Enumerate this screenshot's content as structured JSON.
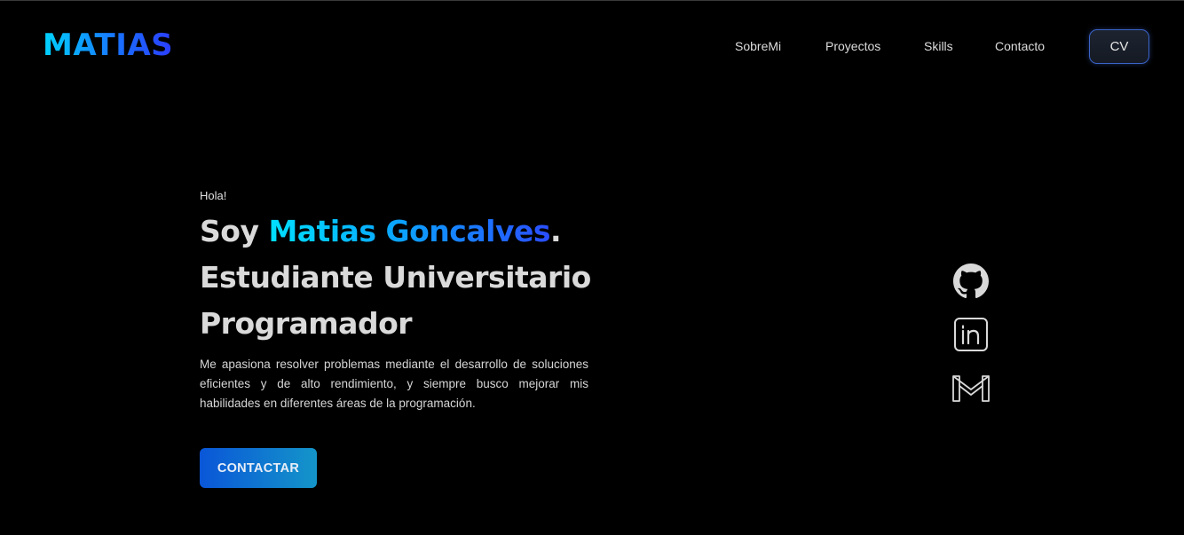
{
  "header": {
    "logo": "MATIAS",
    "nav": [
      "SobreMi",
      "Proyectos",
      "Skills",
      "Contacto"
    ],
    "cv_label": "CV"
  },
  "hero": {
    "greeting": "Hola!",
    "intro_prefix": "Soy ",
    "name": "Matias Goncalves",
    "intro_suffix": ".",
    "line2": "Estudiante Universitario",
    "line3": "Programador",
    "description": "Me apasiona resolver problemas mediante el desarrollo de soluciones eficientes y de alto rendimiento, y siempre busco mejorar mis habilidades en diferentes áreas de la programación.",
    "cta_label": "CONTACTAR"
  },
  "socials": [
    {
      "icon": "github-icon"
    },
    {
      "icon": "linkedin-icon"
    },
    {
      "icon": "gmail-icon"
    }
  ],
  "colors": {
    "background": "#000000",
    "accent_start": "#00e0ff",
    "accent_end": "#2a4dff",
    "cta_start": "#0a56d8",
    "cta_end": "#1495c9"
  }
}
